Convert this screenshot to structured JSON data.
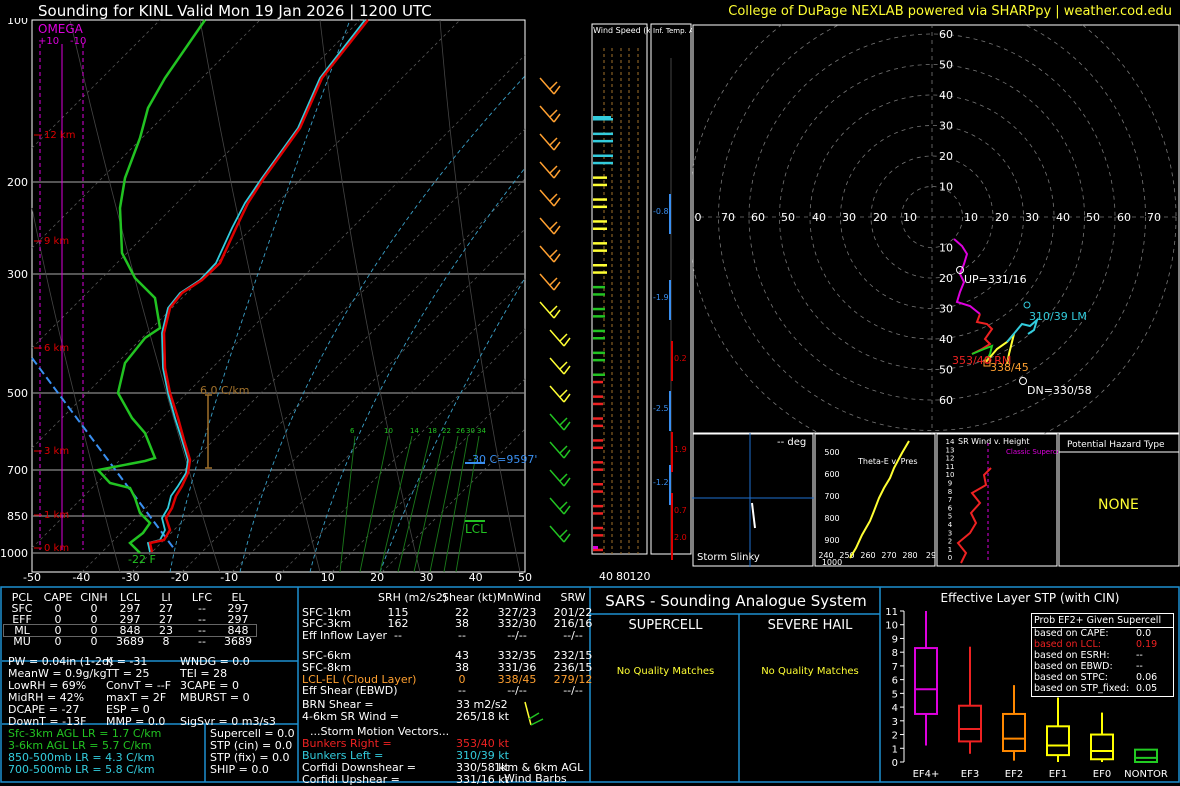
{
  "header": {
    "title": "Sounding for KINL Valid  Mon 19 Jan 2026 | 1200 UTC",
    "credit": "College of DuPage NEXLAB powered via SHARPpy | weather.cod.edu"
  },
  "colors": {
    "temp": "#dd0000",
    "dewpoint": "#22c322",
    "wetbulb": "#33ccdd",
    "omega": "#dd00dd",
    "frame": "#1e8fd0",
    "yellow": "#ffff33"
  },
  "skewt": {
    "omega_label": "OMEGA",
    "omega_ticks": [
      "+10",
      "-10"
    ],
    "pressure_labels": [
      "100",
      "200",
      "300",
      "500",
      "700",
      "850",
      "1000"
    ],
    "temp_labels": [
      "-50",
      "-40",
      "-30",
      "-20",
      "-10",
      "0",
      "10",
      "20",
      "30",
      "40",
      "50"
    ],
    "height_labels": [
      "12 km",
      "9 km",
      "6 km",
      "3 km",
      "1 km",
      "0 km"
    ],
    "lapse_label": "6.0 C/km",
    "mixing_ratio_labels": [
      "6",
      "10",
      "14",
      "18",
      "22",
      "26",
      "30",
      "34"
    ],
    "lcl_label": "LCL",
    "isotherm_label": "-30 C=9597'",
    "sfc_label": "-22 F"
  },
  "wind_speed": {
    "title": "Wind Speed (knots)",
    "ticks": [
      "40",
      "80",
      "120"
    ]
  },
  "inferred_temp": {
    "title": "Inf. Temp. Adv. (C/hr)",
    "values": [
      "-0.8",
      "-1.9",
      "0.2",
      "-2.5",
      "1.9",
      "-1.2",
      "0.7",
      "2.0"
    ]
  },
  "hodograph": {
    "ring_labels_y": [
      "60",
      "50",
      "40",
      "30",
      "20",
      "10"
    ],
    "ring_labels_x": [
      "0",
      "70",
      "60",
      "50",
      "40",
      "30",
      "20",
      "10",
      "10",
      "20",
      "30",
      "40",
      "50",
      "60",
      "70"
    ],
    "ring_labels_y_low": [
      "10",
      "20",
      "30",
      "40",
      "50",
      "60"
    ],
    "up": "UP=331/16",
    "lm": "310/39 LM",
    "rm": "353/40 RM",
    "mean": "338/45",
    "dn": "DN=330/58"
  },
  "storm_slinky": {
    "title": "-- deg",
    "label": "Storm Slinky"
  },
  "theta_e": {
    "title": "Theta-E v. Pres",
    "y_labels": [
      "500",
      "600",
      "700",
      "800",
      "900",
      "1000"
    ],
    "x_labels": [
      "240",
      "250",
      "260",
      "270",
      "280",
      "29"
    ]
  },
  "srwind": {
    "title": "SR Wind v. Height",
    "y_labels": [
      "14",
      "13",
      "12",
      "11",
      "10",
      "9",
      "8",
      "7",
      "6",
      "5",
      "4",
      "3",
      "2",
      "1",
      "0"
    ],
    "note": "Classic Supercell"
  },
  "hazard": {
    "title": "Potential Hazard Type",
    "value": "NONE"
  },
  "parcels": {
    "headers": [
      "PCL",
      "CAPE",
      "CINH",
      "LCL",
      "LI",
      "LFC",
      "EL"
    ],
    "rows": [
      [
        "SFC",
        "0",
        "0",
        "297",
        "27",
        "--",
        "297"
      ],
      [
        "EFF",
        "0",
        "0",
        "297",
        "27",
        "--",
        "297"
      ],
      [
        "ML",
        "0",
        "0",
        "848",
        "23",
        "--",
        "848"
      ],
      [
        "MU",
        "0",
        "0",
        "3689",
        "8",
        "--",
        "3689"
      ]
    ]
  },
  "indices": {
    "col1": [
      "PW = 0.04in (1-2σ)",
      "MeanW = 0.9g/kg",
      "LowRH = 69%",
      "MidRH = 42%",
      "DCAPE = -27",
      "DownT = -13F"
    ],
    "col2": [
      "K = -31",
      "TT = 25",
      "ConvT = --F",
      "maxT = 2F",
      "ESP = 0",
      "MMP = 0.0"
    ],
    "col3": [
      "WNDG = 0.0",
      "TEI = 28",
      "3CAPE = 0",
      "MBURST = 0",
      "",
      "SigSvr = 0 m3/s3"
    ]
  },
  "lapse_rates": [
    "Sfc-3km AGL LR = 1.7 C/km",
    "3-6km AGL LR = 5.7 C/km",
    "850-500mb LR = 4.3 C/km",
    "700-500mb LR = 5.8 C/km"
  ],
  "composite": [
    "Supercell = 0.0",
    "STP (cin) = 0.0",
    "STP (fix) = 0.0",
    "SHIP = 0.0"
  ],
  "kinematics": {
    "headers": [
      "SRH (m2/s2)",
      "Shear (kt)",
      "MnWind",
      "SRW"
    ],
    "rows": [
      [
        "SFC-1km",
        "115",
        "22",
        "327/23",
        "201/22"
      ],
      [
        "SFC-3km",
        "162",
        "38",
        "332/30",
        "216/16"
      ],
      [
        "Eff Inflow Layer",
        "--",
        "--",
        "--/--",
        "--/--"
      ],
      [
        "",
        "",
        "",
        "",
        ""
      ],
      [
        "SFC-6km",
        "",
        "43",
        "332/35",
        "232/15"
      ],
      [
        "SFC-8km",
        "",
        "38",
        "331/36",
        "236/15"
      ],
      [
        "LCL-EL (Cloud Layer)",
        "",
        "0",
        "338/45",
        "279/12"
      ],
      [
        "Eff Shear (EBWD)",
        "",
        "--",
        "--/--",
        "--/--"
      ]
    ],
    "brn_shear_label": "BRN Shear =",
    "brn_shear": "33 m2/s2",
    "sr_wind_label": "4-6km SR Wind =",
    "sr_wind": "265/18 kt",
    "storm_motion_title": "...Storm Motion Vectors...",
    "motions": [
      [
        "Bunkers Right =",
        "353/40 kt"
      ],
      [
        "Bunkers Left =",
        "310/39 kt"
      ],
      [
        "Corfidi Downshear =",
        "330/58 kt"
      ],
      [
        "Corfidi Upshear =",
        "331/16 kt"
      ]
    ],
    "barb_label_1": "1km & 6km AGL",
    "barb_label_2": "Wind Barbs"
  },
  "sars": {
    "title": "SARS - Sounding Analogue System",
    "supercell": "SUPERCELL",
    "hail": "SEVERE HAIL",
    "supercell_result": "No Quality Matches",
    "hail_result": "No Quality Matches"
  },
  "stp": {
    "title": "Effective Layer STP (with CIN)",
    "y_labels": [
      "11",
      "10",
      "9",
      "8",
      "7",
      "6",
      "5",
      "4",
      "3",
      "2",
      "1",
      "0"
    ],
    "prob_title": "Prob EF2+ Given Supercell",
    "prob_rows": [
      [
        "based on CAPE:",
        "0.0"
      ],
      [
        "based on LCL:",
        "0.19"
      ],
      [
        "based on ESRH:",
        "--"
      ],
      [
        "based on EBWD:",
        "--"
      ],
      [
        "based on STPC:",
        "0.06"
      ],
      [
        "based on STP_fixed:",
        "0.05"
      ]
    ]
  },
  "chart_data": {
    "type": "box",
    "title": "Effective Layer STP (with CIN)",
    "categories": [
      "EF4+",
      "EF3",
      "EF2",
      "EF1",
      "EF0",
      "NONTOR"
    ],
    "ylim": [
      0,
      11
    ],
    "boxes": [
      {
        "whisker_low": 1.2,
        "q1": 3.5,
        "median": 5.3,
        "q3": 8.3,
        "whisker_high": 11.0,
        "color": "#dd00dd"
      },
      {
        "whisker_low": 0.6,
        "q1": 1.5,
        "median": 2.4,
        "q3": 4.1,
        "whisker_high": 8.4,
        "color": "#ee2222"
      },
      {
        "whisker_low": 0.1,
        "q1": 0.8,
        "median": 1.7,
        "q3": 3.5,
        "whisker_high": 5.6,
        "color": "#ff8800"
      },
      {
        "whisker_low": 0.0,
        "q1": 0.5,
        "median": 1.2,
        "q3": 2.6,
        "whisker_high": 4.7,
        "color": "#ffff00"
      },
      {
        "whisker_low": 0.0,
        "q1": 0.2,
        "median": 0.8,
        "q3": 2.0,
        "whisker_high": 3.6,
        "color": "#ffff00"
      },
      {
        "whisker_low": 0.0,
        "q1": 0.0,
        "median": 0.3,
        "q3": 0.9,
        "whisker_high": 0.9,
        "color": "#22cc22"
      }
    ]
  }
}
